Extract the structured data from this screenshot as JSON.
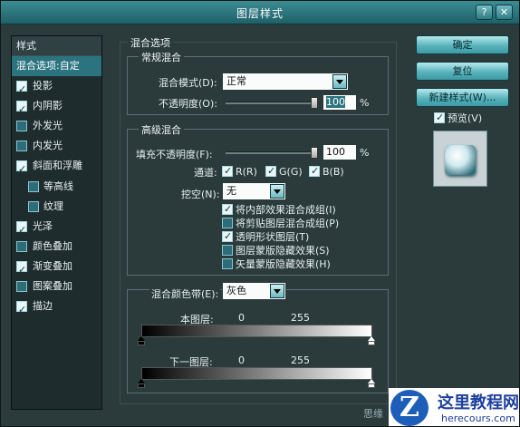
{
  "window": {
    "title": "图层样式",
    "btn_help": "?",
    "btn_close": "✕"
  },
  "styles": {
    "header": "样式",
    "selected": "混合选项:自定",
    "items": [
      {
        "label": "投影",
        "checked": true,
        "sub": false
      },
      {
        "label": "内阴影",
        "checked": true,
        "sub": false
      },
      {
        "label": "外发光",
        "checked": false,
        "sub": false
      },
      {
        "label": "内发光",
        "checked": false,
        "sub": false
      },
      {
        "label": "斜面和浮雕",
        "checked": true,
        "sub": false
      },
      {
        "label": "等高线",
        "checked": false,
        "sub": true
      },
      {
        "label": "纹理",
        "checked": false,
        "sub": true
      },
      {
        "label": "光泽",
        "checked": true,
        "sub": false
      },
      {
        "label": "颜色叠加",
        "checked": false,
        "sub": false
      },
      {
        "label": "渐变叠加",
        "checked": true,
        "sub": false
      },
      {
        "label": "图案叠加",
        "checked": false,
        "sub": false
      },
      {
        "label": "描边",
        "checked": true,
        "sub": false
      }
    ]
  },
  "buttons": {
    "ok": "确定",
    "reset": "复位",
    "new_style": "新建样式(W)..."
  },
  "preview": {
    "label": "预览(V)",
    "checked": true
  },
  "blend": {
    "section": "混合选项",
    "general": {
      "title": "常规混合",
      "mode_label": "混合模式(D):",
      "mode_value": "正常",
      "opacity_label": "不透明度(O):",
      "opacity_value": "100",
      "percent": "%"
    },
    "advanced": {
      "title": "高级混合",
      "fill_label": "填充不透明度(F):",
      "fill_value": "100",
      "percent": "%",
      "channels_label": "通道:",
      "ch_r": "R(R)",
      "ch_g": "G(G)",
      "ch_b": "B(B)",
      "knockout_label": "挖空(N):",
      "knockout_value": "无",
      "opt1": "将内部效果混合成组(I)",
      "opt2": "将剪贴图层混合成组(P)",
      "opt3": "透明形状图层(T)",
      "opt4": "图层蒙版隐藏效果(S)",
      "opt5": "矢量蒙版隐藏效果(H)"
    },
    "blendif": {
      "label": "混合颜色带(E):",
      "value": "灰色",
      "this_layer": "本图层:",
      "this_min": "0",
      "this_max": "255",
      "under_layer": "下一图层:",
      "under_min": "0",
      "under_max": "255"
    }
  },
  "watermark": {
    "partial": "思缘",
    "brand": "这里教程网",
    "url": "herecours.com",
    "logo_letter": "Z"
  }
}
